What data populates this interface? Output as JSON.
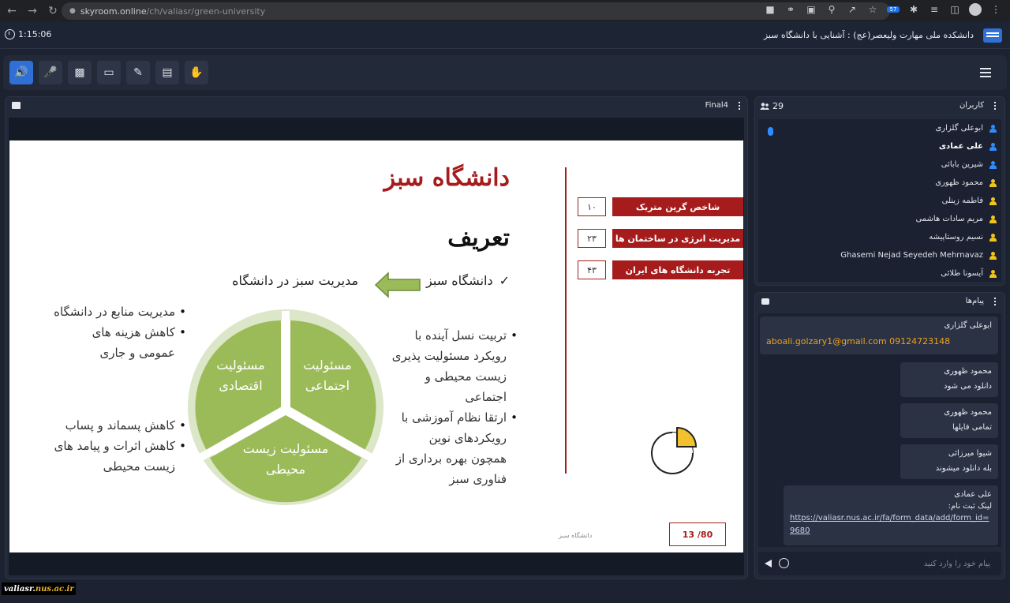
{
  "browser": {
    "url_host": "skyroom.online",
    "url_path": "/ch/valiasr/green-university",
    "extension_badge": "57"
  },
  "header": {
    "timer": "1:15:06",
    "room_title": "دانشکده ملی مهارت ولیعصر(عج) : آشنایی با دانشگاه سبز"
  },
  "presentation": {
    "file_name": "Final4",
    "slide": {
      "title": "دانشگاه سبز",
      "subtitle": "تعریف",
      "definition_left": "دانشگاه سبز",
      "definition_right": "مدیریت سبز در دانشگاه",
      "stats": [
        {
          "label": "شاخص گرین متریک",
          "value": "۱۰"
        },
        {
          "label": "مدیریت انرژی در ساختمان ها",
          "value": "۲۳"
        },
        {
          "label": "تجربه دانشگاه های ایران",
          "value": "۴۳"
        }
      ],
      "bullets_social": [
        "تربیت نسل آینده با رویکرد مسئولیت پذیری زیست محیطی و اجتماعی",
        "ارتقا نظام آموزشی با رویکردهای نوین همچون بهره برداری از فناوری سبز"
      ],
      "bullets_economic": [
        "مدیریت منابع در دانشگاه",
        "کاهش هزینه های عمومی و جاری"
      ],
      "bullets_environment": [
        "کاهش پسماند و پساب",
        "کاهش اثرات و پیامد های زیست محیطی"
      ],
      "cycle": {
        "social": "مسئولیت اجتماعی",
        "economic": "مسئولیت اقتصادی",
        "environment": "مسئولیت زیست محیطی"
      },
      "footer_text": "دانشگاه سبز",
      "page": "13 /80"
    }
  },
  "users": {
    "title": "کاربران",
    "count": "29",
    "list": [
      {
        "name": "ابوعلی گلزاری",
        "role": "host",
        "bold": false
      },
      {
        "name": "علی عمادی",
        "role": "host",
        "bold": true
      },
      {
        "name": "شیرین بابائی",
        "role": "host",
        "bold": false
      },
      {
        "name": "محمود ظهوری",
        "role": "guest",
        "bold": false
      },
      {
        "name": "فاطمه زینلی",
        "role": "guest",
        "bold": false
      },
      {
        "name": "مریم سادات هاشمی",
        "role": "guest",
        "bold": false
      },
      {
        "name": "نسیم روستاپیشه",
        "role": "guest",
        "bold": false
      },
      {
        "name": "Ghasemi Nejad Seyedeh Mehrnavaz",
        "role": "guest",
        "bold": false
      },
      {
        "name": "آیسونا طلائی",
        "role": "guest",
        "bold": false
      }
    ]
  },
  "chat": {
    "title": "پیام‌ها",
    "messages": [
      {
        "sender": "ابوعلی گلزاری",
        "text": "aboali.golzary1@gmail.com 09124723148"
      },
      {
        "sender": "محمود ظهوری",
        "text": "دانلود می شود"
      },
      {
        "sender": "محمود ظهوری",
        "text": "تمامی فایلها"
      },
      {
        "sender": "شیوا میرزائی",
        "text": "بله دانلود میشوند"
      },
      {
        "sender": "علی عمادی",
        "text": "لینک ثبت نام:",
        "link": "https://valiasr.nus.ac.ir/fa/form_data/add/form_id=9680"
      }
    ],
    "input_placeholder": "پیام خود را وارد کنید"
  },
  "watermark": {
    "main": "valiasr.",
    "accent": "nus.ac.ir"
  },
  "colors": {
    "accent": "#2f6fd6",
    "slide_red": "#a61c1c",
    "cycle_green": "#9bbb59",
    "host_icon": "#2f8cff",
    "guest_icon": "#f0c419"
  }
}
